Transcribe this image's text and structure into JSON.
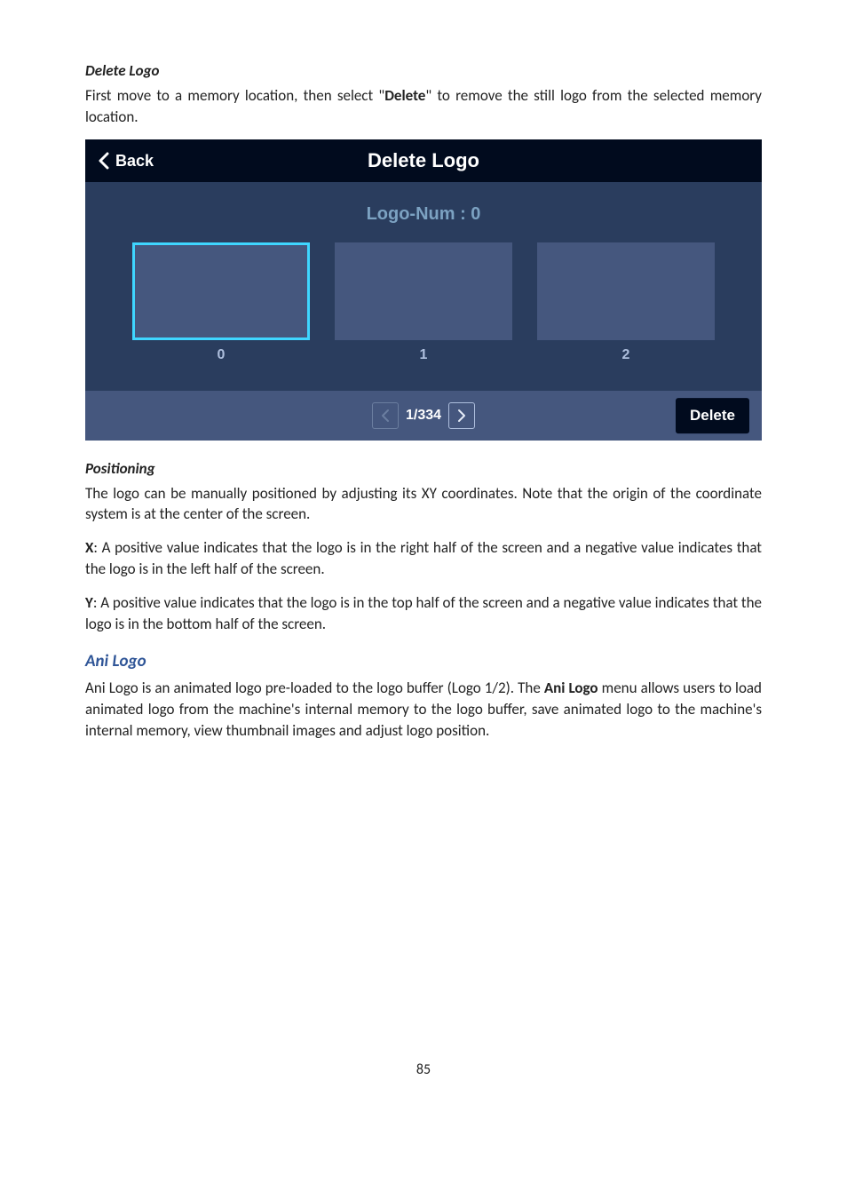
{
  "sec1": {
    "heading": "Delete Logo",
    "para_pre": "First move to a memory location, then select \"",
    "para_bold": "Delete",
    "para_post": "\" to remove the still logo from the selected memory location."
  },
  "device": {
    "back": "Back",
    "title": "Delete Logo",
    "logo_num": "Logo-Num : 0",
    "slots": [
      "0",
      "1",
      "2"
    ],
    "pager": "1/334",
    "delete": "Delete"
  },
  "sec2": {
    "heading": "Positioning",
    "intro": "The logo can be manually positioned by adjusting its XY coordinates. Note that the origin of the coordinate system is at the center of the screen.",
    "x_label": "X",
    "x_text": ": A positive value indicates that the logo is in the right half of the screen and a negative value indicates that the logo is in the left half of the screen.",
    "y_label": "Y",
    "y_text": ": A positive value indicates that the logo is in the top half of the screen and a negative value indicates that the logo is in the bottom half of the screen."
  },
  "sec3": {
    "heading": "Ani Logo",
    "p_pre": "Ani Logo is an animated logo pre-loaded to the logo buffer (Logo 1/2). The ",
    "p_bold": "Ani Logo",
    "p_post": " menu allows users to load animated logo from the machine's internal memory to the logo buffer, save animated logo to the machine's internal memory, view thumbnail images and adjust logo position."
  },
  "page_number": "85"
}
